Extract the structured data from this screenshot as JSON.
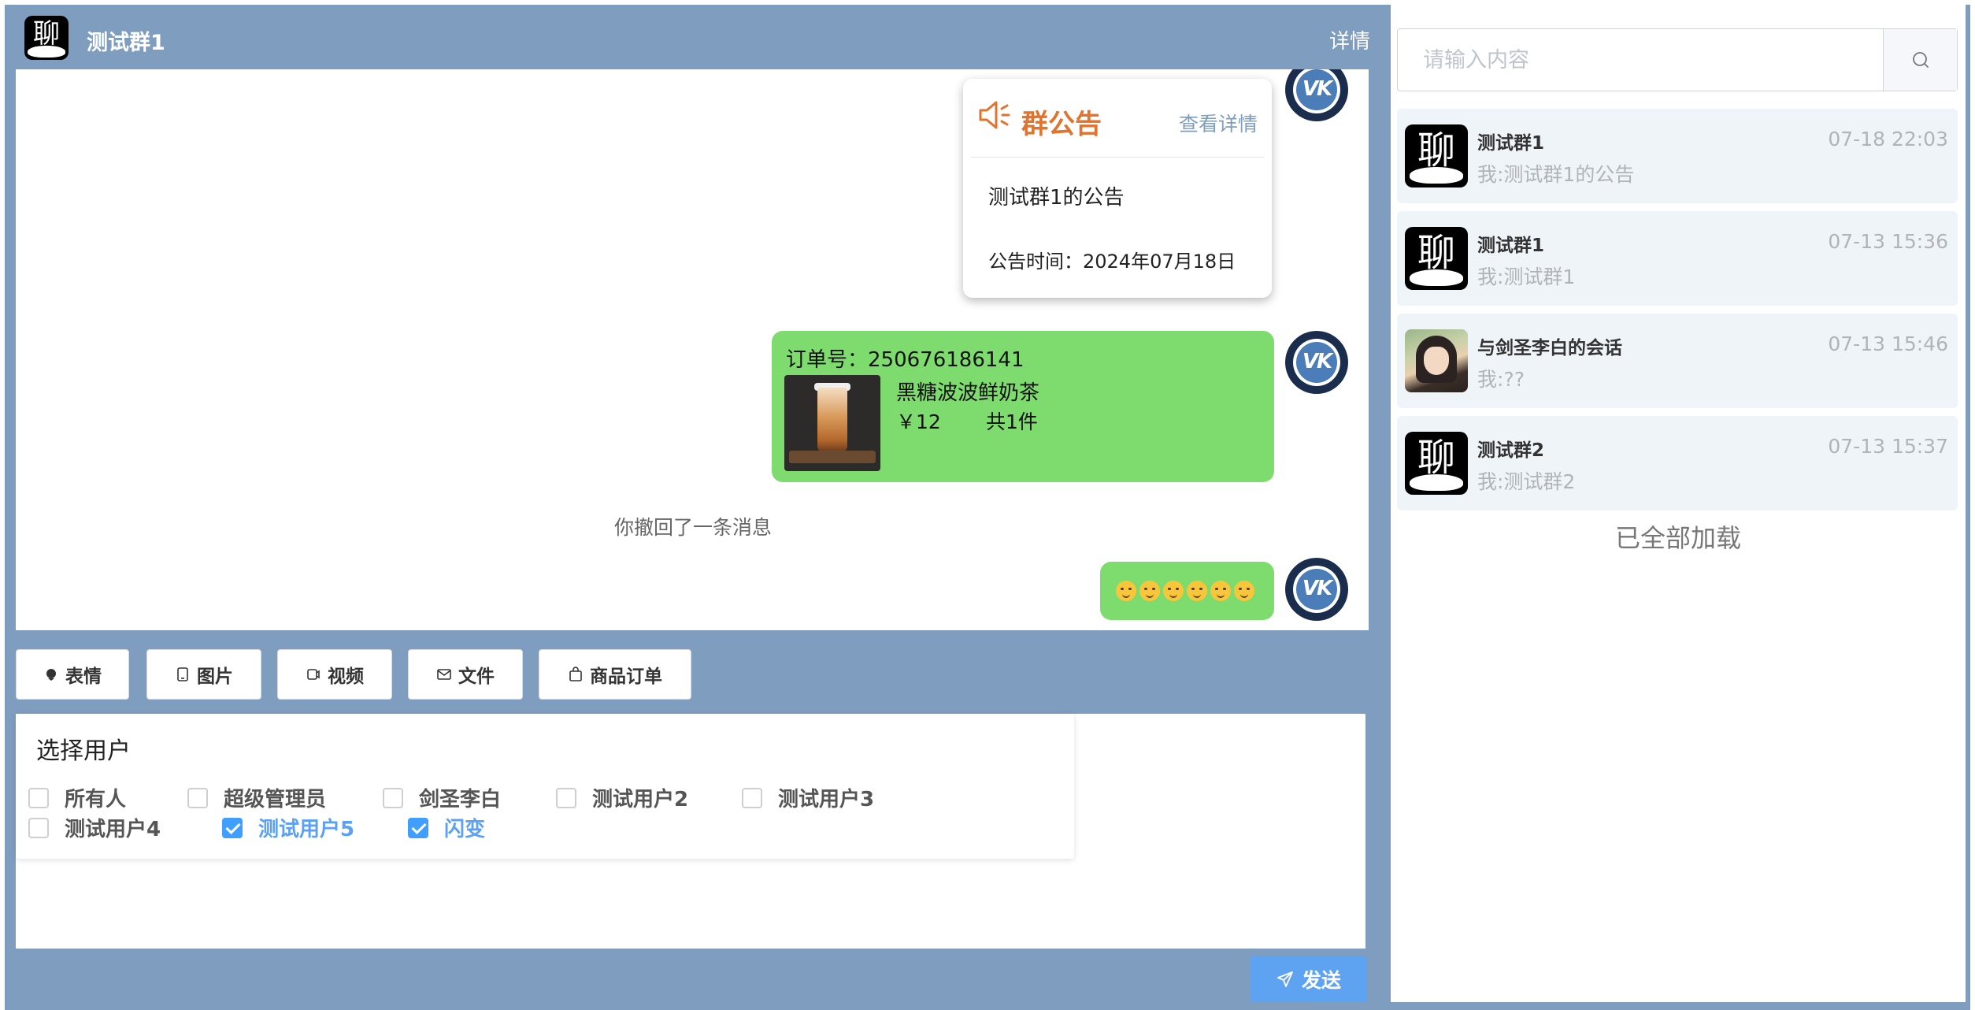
{
  "header": {
    "title": "测试群1",
    "detail_label": "详情",
    "logo_glyph": "聊"
  },
  "messages": {
    "notice": {
      "title": "群公告",
      "more_label": "查看详情",
      "content": "测试群1的公告",
      "time_label": "公告时间：",
      "time_value": "2024年07月18日",
      "icon": "speaker-icon",
      "accent": "#e0732e"
    },
    "order": {
      "order_no_label": "订单号：",
      "order_no": "250676186141",
      "product_name": "黑糖波波鲜奶茶",
      "price": "￥12",
      "count": "共1件",
      "bubble_color": "#7edb6e"
    },
    "recall_text": "你撤回了一条消息",
    "emoji_count": 6,
    "avatar_text": "VK"
  },
  "toolbar": {
    "emoji_label": "表情",
    "image_label": "图片",
    "video_label": "视频",
    "file_label": "文件",
    "order_label": "商品订单"
  },
  "mention": {
    "title": "选择用户",
    "options": [
      {
        "label": "所有人",
        "checked": false
      },
      {
        "label": "超级管理员",
        "checked": false
      },
      {
        "label": "剑圣李白",
        "checked": false
      },
      {
        "label": "测试用户2",
        "checked": false
      },
      {
        "label": "测试用户3",
        "checked": false
      },
      {
        "label": "测试用户4",
        "checked": false
      },
      {
        "label": "测试用户5",
        "checked": true
      },
      {
        "label": "闪变",
        "checked": true
      }
    ]
  },
  "send": {
    "label": "发送"
  },
  "sidebar": {
    "search_placeholder": "请输入内容",
    "conversations": [
      {
        "name": "测试群1",
        "time": "07-18 22:03",
        "preview": "我:测试群1的公告"
      },
      {
        "name": "测试群1",
        "time": "07-13 15:36",
        "preview": "我:测试群1"
      },
      {
        "name": "与剑圣李白的会话",
        "time": "07-13 15:46",
        "preview": "我:??"
      },
      {
        "name": "测试群2",
        "time": "07-13 15:37",
        "preview": "我:测试群2"
      }
    ],
    "loaded_all_text": "已全部加载"
  },
  "colors": {
    "frame": "#7f9dbf",
    "checkbox_checked": "#409eff",
    "send_button": "#5ea3f2"
  }
}
